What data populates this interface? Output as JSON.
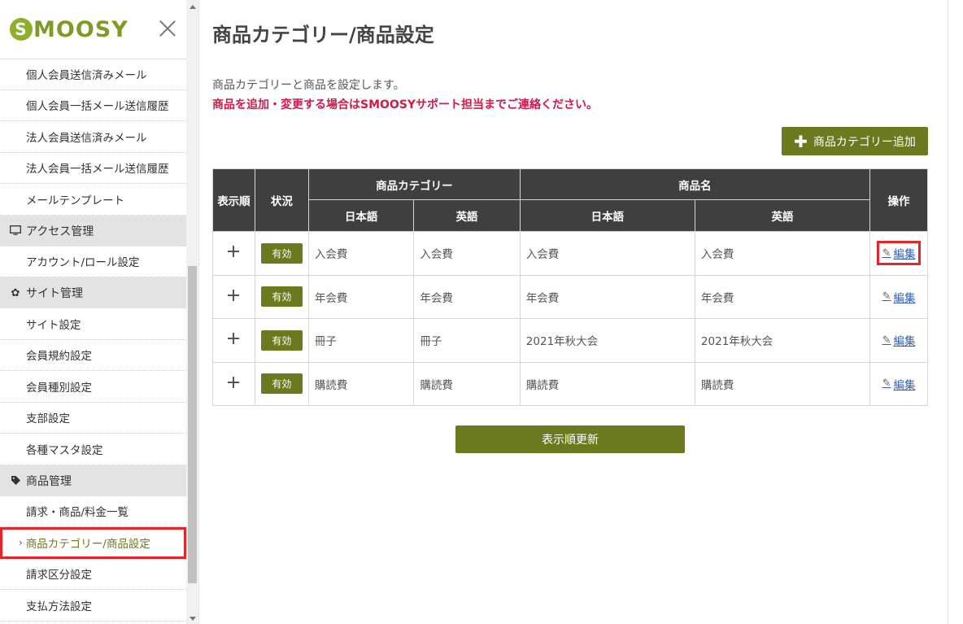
{
  "sidebar": {
    "logo_text": "SMOOSY",
    "logo_initial": "S",
    "items_top": [
      "個人会員送信済みメール",
      "個人会員一括メール送信履歴",
      "法人会員送信済みメール",
      "法人会員一括メール送信履歴",
      "メールテンプレート"
    ],
    "section_access": {
      "label": "アクセス管理",
      "icon": "monitor-icon"
    },
    "items_access": [
      "アカウント/ロール設定"
    ],
    "section_site": {
      "label": "サイト管理",
      "icon": "gear-icon"
    },
    "items_site": [
      "サイト設定",
      "会員規約設定",
      "会員種別設定",
      "支部設定",
      "各種マスタ設定"
    ],
    "section_product": {
      "label": "商品管理",
      "icon": "tag-icon"
    },
    "items_product": [
      "請求・商品/料金一覧",
      "商品カテゴリー/商品設定",
      "請求区分設定",
      "支払方法設定"
    ]
  },
  "main": {
    "title": "商品カテゴリー/商品設定",
    "description": "商品カテゴリーと商品を設定します。",
    "notice": "商品を追加・変更する場合はSMOOSYサポート担当までご連絡ください。",
    "add_button": "商品カテゴリー追加",
    "update_button": "表示順更新"
  },
  "table": {
    "headers": {
      "order": "表示順",
      "status": "状況",
      "category": "商品カテゴリー",
      "product": "商品名",
      "operation": "操作",
      "ja": "日本語",
      "en": "英語"
    },
    "rows": [
      {
        "status": "有効",
        "cat_ja": "入会費",
        "cat_en": "入会費",
        "prod_ja": "入会費",
        "prod_en": "入会費",
        "action": "編集"
      },
      {
        "status": "有効",
        "cat_ja": "年会費",
        "cat_en": "年会費",
        "prod_ja": "年会費",
        "prod_en": "年会費",
        "action": "編集"
      },
      {
        "status": "有効",
        "cat_ja": "冊子",
        "cat_en": "冊子",
        "prod_ja": "2021年秋大会",
        "prod_en": "2021年秋大会",
        "action": "編集"
      },
      {
        "status": "有効",
        "cat_ja": "購読費",
        "cat_en": "購読費",
        "prod_ja": "購読費",
        "prod_en": "購読費",
        "action": "編集"
      }
    ]
  },
  "colors": {
    "accent": "#6b7a1e",
    "notice": "#d4184a",
    "highlight": "#e8232a",
    "header_bg": "#3f3f3f"
  }
}
